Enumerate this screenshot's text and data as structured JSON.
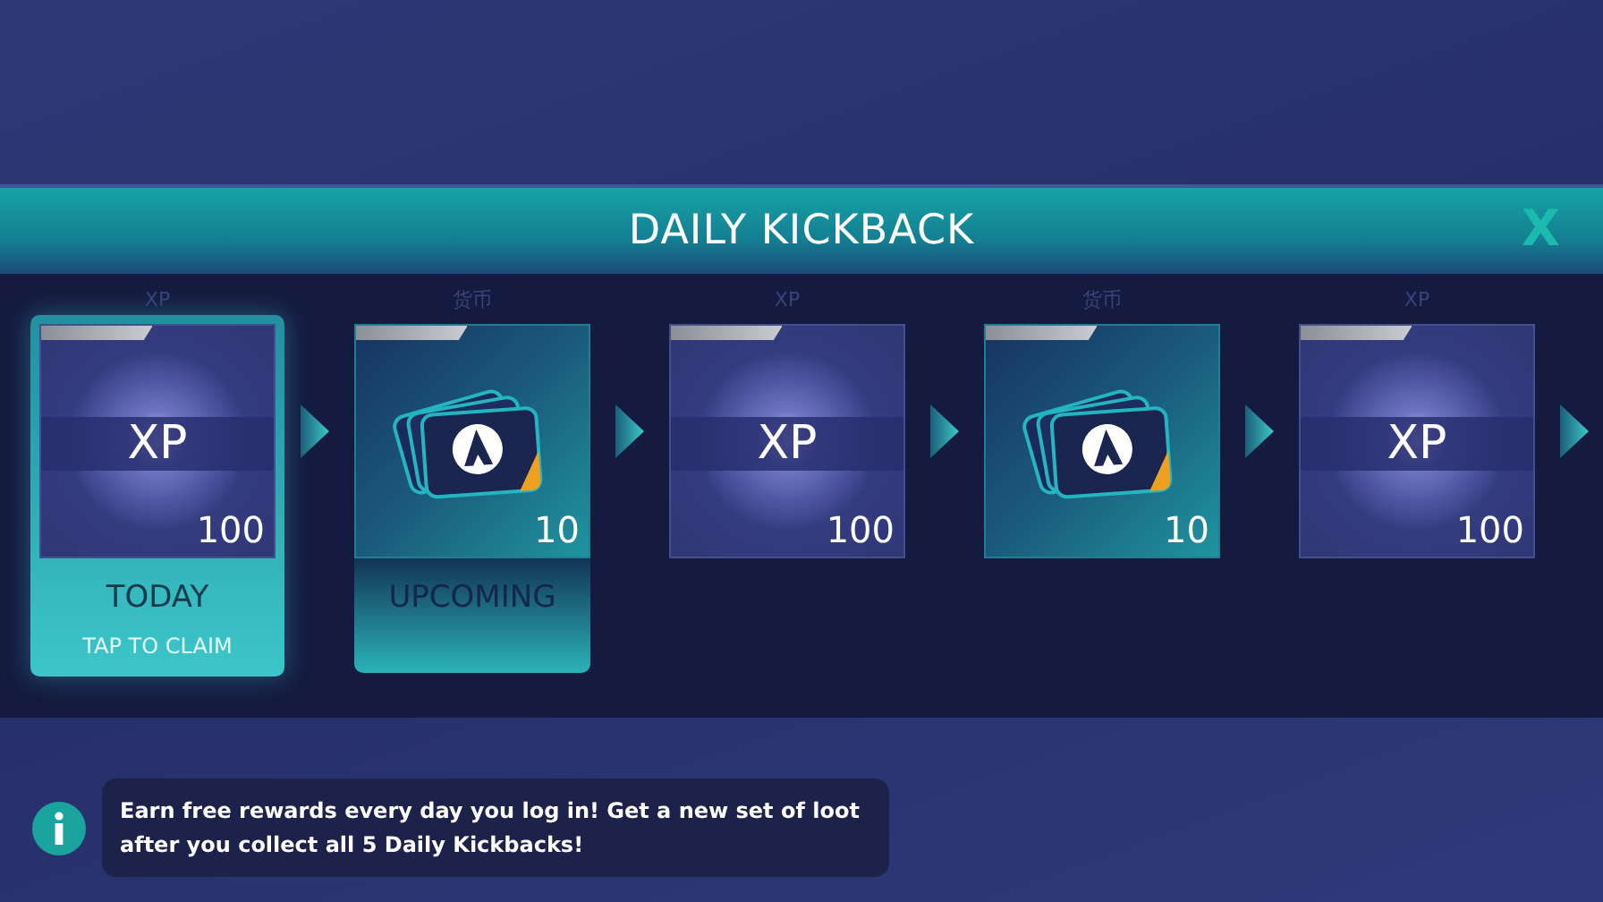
{
  "header": {
    "title": "DAILY KICKBACK",
    "close_label": "X"
  },
  "rewards": [
    {
      "category": "XP",
      "kind": "xp",
      "icon_label": "XP",
      "amount": "100",
      "status_label": "TODAY",
      "action": "TAP TO CLAIM",
      "selected": true
    },
    {
      "category": "货币",
      "kind": "currency",
      "amount": "10",
      "status_label": "UPCOMING",
      "selected": false
    },
    {
      "category": "XP",
      "kind": "xp",
      "icon_label": "XP",
      "amount": "100",
      "selected": false
    },
    {
      "category": "货币",
      "kind": "currency",
      "amount": "10",
      "selected": false
    },
    {
      "category": "XP",
      "kind": "xp",
      "icon_label": "XP",
      "amount": "100",
      "selected": false
    }
  ],
  "info": {
    "text": "Earn free rewards every day you log in! Get a new set of loot after you collect all 5 Daily Kickbacks!"
  }
}
